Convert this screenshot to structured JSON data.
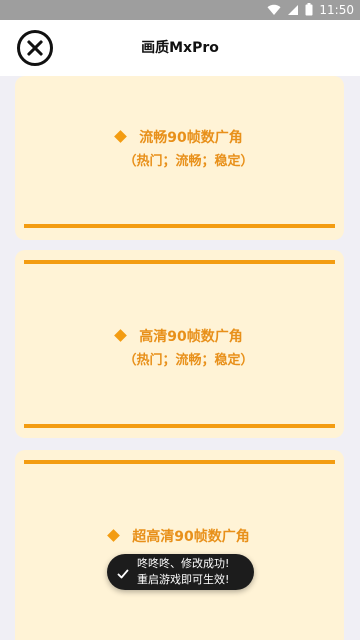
{
  "status_bar": {
    "time": "11:50"
  },
  "header": {
    "title": "画质MxPro"
  },
  "cards": [
    {
      "title": "流畅90帧数广角",
      "tags": "（热门；流畅；稳定）"
    },
    {
      "title": "高清90帧数广角",
      "tags": "（热门；流畅；稳定）"
    },
    {
      "title": "超高清90帧数广角"
    }
  ],
  "toast": {
    "line1": "咚咚咚、修改成功!",
    "line2": "重启游戏即可生效!"
  },
  "colors": {
    "accent": "#f39c12",
    "text_accent": "#e8901a",
    "card_bg": "#fff3d6",
    "page_bg": "#f0eff5",
    "status_bar": "#9e9e9e"
  }
}
